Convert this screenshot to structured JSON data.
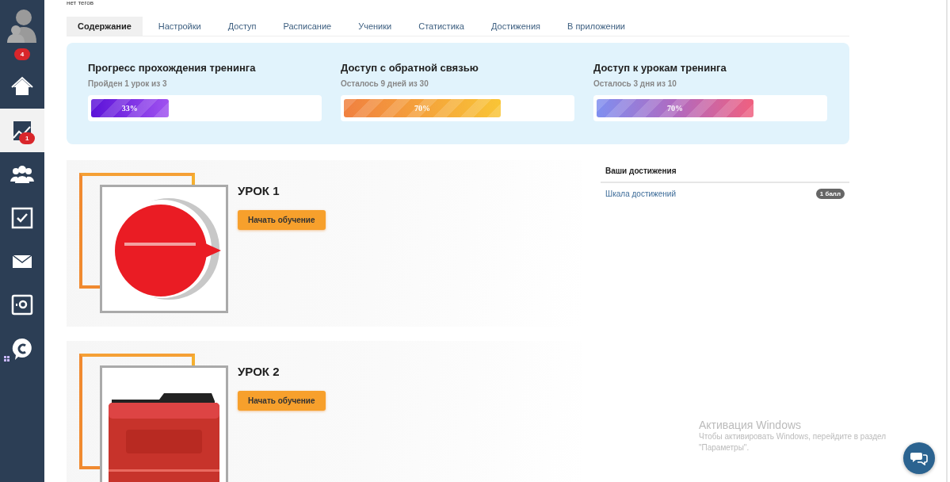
{
  "tags_note": "нет тегов",
  "sidebar": {
    "avatar_badge": "4",
    "items": [
      {
        "selected": false
      },
      {
        "selected": true,
        "badge": "1"
      },
      {
        "selected": false
      },
      {
        "selected": false
      },
      {
        "selected": false
      },
      {
        "selected": false
      },
      {
        "selected": false
      }
    ]
  },
  "tabs": [
    {
      "label": "Содержание",
      "selected": true
    },
    {
      "label": "Настройки",
      "selected": false
    },
    {
      "label": "Доступ",
      "selected": false
    },
    {
      "label": "Расписание",
      "selected": false
    },
    {
      "label": "Ученики",
      "selected": false
    },
    {
      "label": "Статистика",
      "selected": false
    },
    {
      "label": "Достижения",
      "selected": false
    },
    {
      "label": "В приложении",
      "selected": false
    }
  ],
  "progress": [
    {
      "title": "Прогресс прохождения тренинга",
      "subtitle": "Пройден 1 урок из 3",
      "level": 0.34,
      "reading": "33%"
    },
    {
      "title": "Доступ с обратной связью",
      "subtitle": "Осталось 9 дней из 30",
      "level": 0.69,
      "reading": "70%"
    },
    {
      "title": "Доступ к урокам тренинга",
      "subtitle": "Осталось 3 дня из 10",
      "level": 0.69,
      "reading": "70%"
    }
  ],
  "lessons": [
    {
      "title": "УРОК 1",
      "button": "Начать обучение",
      "kind": "picture"
    },
    {
      "title": "УРОК 2",
      "button": "Начать обучение",
      "kind": "picture"
    }
  ],
  "achievements": {
    "title": "Ваши достижения",
    "items": [
      {
        "label": "Шкала достижений",
        "badge": "1 балл"
      }
    ]
  },
  "windows_notice": {
    "title": "Активация Windows",
    "text": "Чтобы активировать Windows, перейдите в раздел \"Параметры\"."
  }
}
